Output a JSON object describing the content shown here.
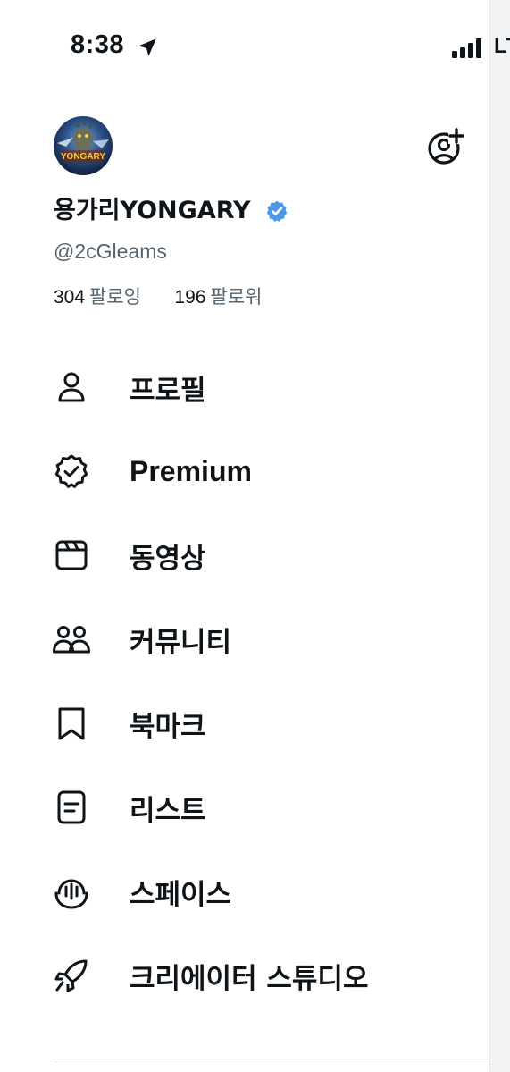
{
  "status_bar": {
    "time": "8:38",
    "network": "LT",
    "icons": [
      "location-arrow-icon",
      "signal-bars-icon"
    ]
  },
  "profile": {
    "display_name": "용가리YONGARY",
    "handle": "@2cGleams",
    "verified": true,
    "verified_color": "#4a99e9",
    "avatar_text": "YONGARY",
    "following_count": "304",
    "following_label": "팔로잉",
    "followers_count": "196",
    "followers_label": "팔로워"
  },
  "menu": {
    "items": [
      {
        "label": "프로필",
        "icon": "person-icon"
      },
      {
        "label": "Premium",
        "icon": "verified-badge-outline-icon"
      },
      {
        "label": "동영상",
        "icon": "video-clapper-icon"
      },
      {
        "label": "커뮤니티",
        "icon": "communities-icon"
      },
      {
        "label": "북마크",
        "icon": "bookmark-icon"
      },
      {
        "label": "리스트",
        "icon": "list-document-icon"
      },
      {
        "label": "스페이스",
        "icon": "spaces-microphone-icon"
      },
      {
        "label": "크리에이터 스튜디오",
        "icon": "rocket-icon"
      }
    ]
  },
  "colors": {
    "text_primary": "#0f1419",
    "text_secondary": "#536471",
    "background": "#ffffff"
  }
}
